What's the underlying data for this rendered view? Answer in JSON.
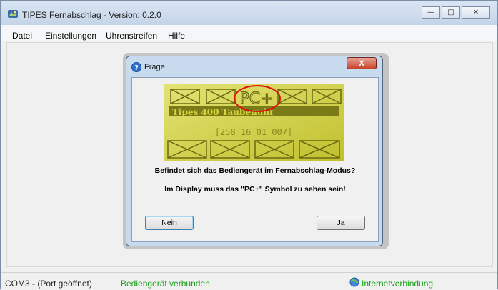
{
  "window": {
    "title": "TIPES Fernabschlag - Version: 0.2.0",
    "controls": {
      "minimize": "—",
      "maximize": "□",
      "close": "✕"
    }
  },
  "menu": [
    "Datei",
    "Einstellungen",
    "Uhrenstreifen",
    "Hilfe"
  ],
  "dialog": {
    "title": "Frage",
    "close_label": "X",
    "lcd": {
      "pc_symbol": "PC+",
      "line1": "Tipes 400 Taubenuhr",
      "line2": "[258  16  01  007]"
    },
    "question": "Befindet sich das Bediengerät im Fernabschlag-Modus?",
    "instruction": "Im Display muss das \"PC+\" Symbol zu sehen sein!",
    "buttons": {
      "no": "Nein",
      "yes": "Ja"
    }
  },
  "status": {
    "port": "COM3  - (Port geöffnet)",
    "device": "Bediengerät verbunden",
    "internet": "Internetverbindung"
  },
  "colors": {
    "status_ok": "#18a018",
    "lcd_background": "#d8d73a",
    "highlight_circle": "#e01010"
  }
}
